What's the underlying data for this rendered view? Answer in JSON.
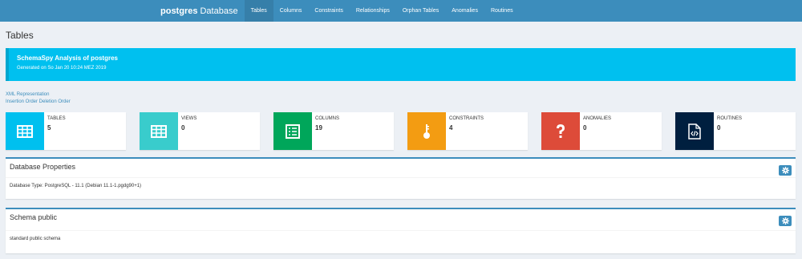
{
  "nav": {
    "brand_bold": "postgres",
    "brand_rest": "Database",
    "items": [
      {
        "label": "Tables",
        "active": true
      },
      {
        "label": "Columns"
      },
      {
        "label": "Constraints"
      },
      {
        "label": "Relationships"
      },
      {
        "label": "Orphan Tables"
      },
      {
        "label": "Anomalies"
      },
      {
        "label": "Routines"
      }
    ]
  },
  "page_title": "Tables",
  "callout": {
    "title": "SchemaSpy Analysis of postgres",
    "generated": "Generated on So Jan 20 10:24 MEZ 2019"
  },
  "links": {
    "xml": "XML Representation",
    "insertion": "Insertion Order Deletion Order"
  },
  "stats": [
    {
      "label": "TABLES",
      "value": "5",
      "color": "#00c0ef",
      "icon": "table-icon"
    },
    {
      "label": "VIEWS",
      "value": "0",
      "color": "#39cccc",
      "icon": "table-icon"
    },
    {
      "label": "COLUMNS",
      "value": "19",
      "color": "#00a65a",
      "icon": "list-icon"
    },
    {
      "label": "CONSTRAINTS",
      "value": "4",
      "color": "#f39c12",
      "icon": "key-icon"
    },
    {
      "label": "ANOMALIES",
      "value": "0",
      "color": "#dd4b39",
      "icon": "question-icon"
    },
    {
      "label": "ROUTINES",
      "value": "0",
      "color": "#001f3f",
      "icon": "code-file-icon"
    }
  ],
  "db_props": {
    "title": "Database Properties",
    "body": "Database Type: PostgreSQL - 11.1 (Debian 11.1-1.pgdg90+1)"
  },
  "schema": {
    "title": "Schema public",
    "body": "standard public schema"
  }
}
